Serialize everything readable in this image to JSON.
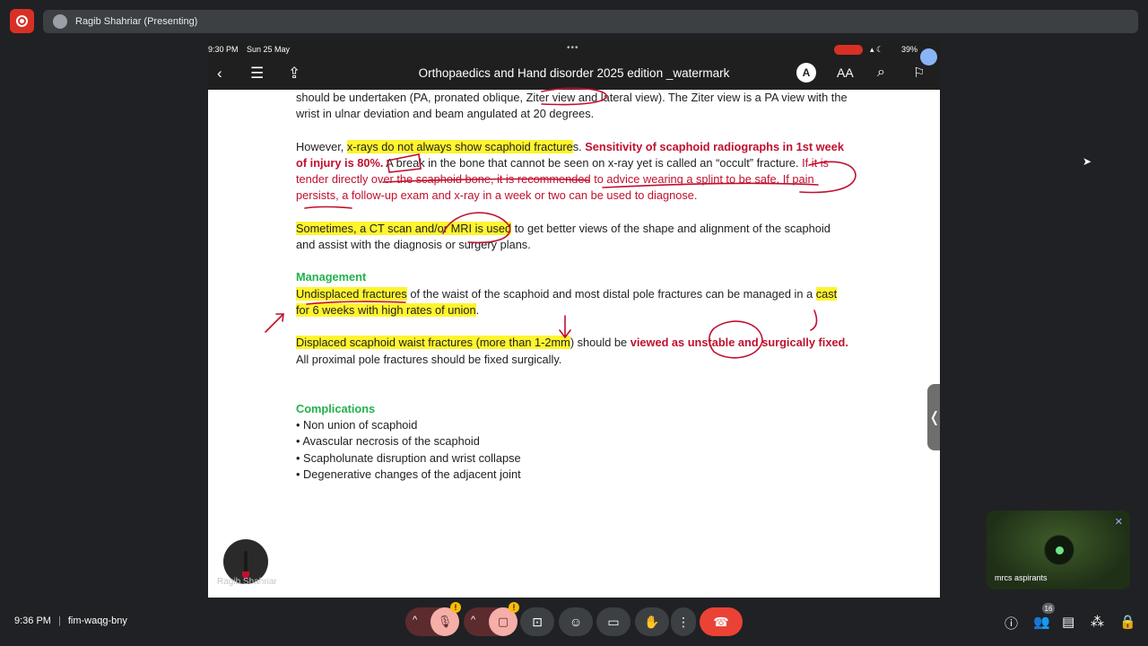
{
  "presenter_bar": {
    "name": "Ragib Shahriar (Presenting)"
  },
  "ipad_status": {
    "time": "9:30 PM",
    "date": "Sun 25 May",
    "battery": "39%"
  },
  "reader": {
    "title": "Orthopaedics and Hand disorder 2025 edition _watermark",
    "aa_label": "AA",
    "annotate_label": "A"
  },
  "document": {
    "p1": {
      "t1": "should be undertaken (PA, pronated oblique, Ziter view and lateral view). The Ziter view is a PA view with the wrist in ulnar deviation and beam angulated at 20 degrees."
    },
    "p2": {
      "t1": "However, ",
      "hl1": "x-rays do not always show scaphoid fracture",
      "t2": "s. ",
      "red1": "Sensitivity of scaphoid radiographs in 1st week of injury is 80%.",
      "t3": " A break in the bone that cannot be seen on x-ray yet is called an “occult” fracture. ",
      "red2": "If it is tender directly over the scaphoid bone, it is recommended to advice wearing a splint to be safe. If pain persists, a follow-up exam and x-ray in a week or two can be used to diagnose."
    },
    "p3": {
      "hl1": "Sometimes, a CT scan and/or MRI is used",
      "t1": " to get better views of the shape and alignment of the scaphoid and assist with the diagnosis or surgery plans."
    },
    "management": {
      "heading": "Management",
      "hl1": "Undisplaced fractures",
      "t1": " of the waist of the scaphoid and most distal pole fractures can be managed in a ",
      "hl2": "cast for 6 weeks with high rates of union",
      "t2": "."
    },
    "p5": {
      "hl1": "Displaced scaphoid waist fractures (more than 1-2mm",
      "t1": ") should be ",
      "red1": "viewed as unstable and surgically fixed.",
      "t2": " All proximal pole fractures should be fixed surgically."
    },
    "complications": {
      "heading": "Complications",
      "items": [
        "• Non union of scaphoid",
        "• Avascular necrosis of the scaphoid",
        "• Scapholunate disruption and wrist collapse",
        "• Degenerative changes of the adjacent joint"
      ]
    }
  },
  "presenter_label": "Ragib Shahriar",
  "tile": {
    "name": "mrcs aspirants"
  },
  "meeting": {
    "time": "9:36 PM",
    "code": "fim-waqg-bny",
    "participants": "16"
  }
}
